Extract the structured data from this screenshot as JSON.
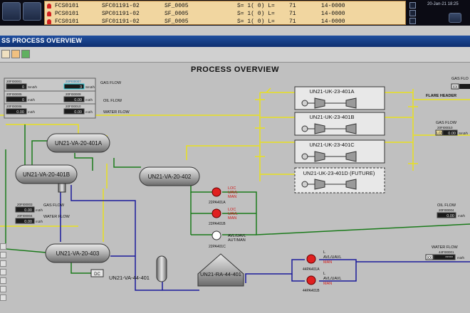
{
  "alarms": [
    {
      "tag": "FCS0101",
      "ref": "SFC01191-02",
      "sf": "SF_0005",
      "state": "S= 1( 0) L=",
      "val": "71",
      "code": "14-0000"
    },
    {
      "tag": "PCS0101",
      "ref": "SPC01191-02",
      "sf": "SF_0005",
      "state": "S= 1( 0) L=",
      "val": "71",
      "code": "14-0000"
    },
    {
      "tag": "FCS0101",
      "ref": "SFC01191-02",
      "sf": "SF_0005",
      "state": "S= 1( 0) L=",
      "val": "71",
      "code": "14-0000"
    }
  ],
  "datetime": "20-Jan-21 18:25",
  "window_title": "SS PROCESS OVERVIEW",
  "page_title": "PROCESS OVERVIEW",
  "left_panel": {
    "rows": [
      {
        "tag1": "20FI00001",
        "val1": "0",
        "unit1": "Sm3/h",
        "tag2": "20PI00007",
        "val2": "3",
        "unit2": "Sm3/h",
        "label": "GAS FLOW"
      },
      {
        "tag1": "20FI00005",
        "val1": "0",
        "unit1": "m3/h",
        "tag2": "20FI00009",
        "val2": "0.00",
        "unit2": "m3/h",
        "label": "OIL FLOW"
      },
      {
        "tag1": "20FI00006",
        "val1": "0.00",
        "unit1": "m3/h",
        "tag2": "20FI00010",
        "val2": "0.00",
        "unit2": "m3/h",
        "label": "WATER FLOW"
      }
    ]
  },
  "vessels": {
    "v401a": "UN21-VA-20-401A",
    "v401b": "UN21-VA-20-401B",
    "v402": "UN21-VA-20-402",
    "v403": "UN21-VA-20-403",
    "v44401": "UN21-VA-44-401",
    "ra44401": "UN21-RA-44-401"
  },
  "compressors": [
    "UN21-UK-23-401A",
    "UN21-UK-23-401B",
    "UN21-UK-23-401C",
    "UN21-UK-23-401D (FUTURE)"
  ],
  "pumps": [
    {
      "tag": "22PA401A",
      "status1": "LOC",
      "status2": "UAVL",
      "status3": "MAN"
    },
    {
      "tag": "22PA401B",
      "status1": "LOC",
      "status2": "UAVL",
      "status3": "MAN"
    },
    {
      "tag": "22PA401C",
      "status1": "AVL/UAVL",
      "status2": "AUT/MAN",
      "status3": ""
    },
    {
      "tag": "44PA401A",
      "status1": "L",
      "status2": "AVL/UAVL",
      "status3": "MAN"
    },
    {
      "tag": "44PA401B",
      "status1": "L",
      "status2": "AVL/UAVL",
      "status3": "MAN"
    }
  ],
  "mid_flows": {
    "gas_tag": "20FI00003",
    "gas_val": "0.00",
    "gas_unit": "m3/h",
    "gas_label": "GAS FLOW",
    "water_tag": "20FI00004",
    "water_val": "0.00",
    "water_unit": "m3/h",
    "water_label": "WATER FLOW"
  },
  "right_panel": {
    "gas_flow_top": "GAS FLO",
    "xx_top": "XX",
    "flare_header": "FLARE HEADER",
    "gas_flow_label": "GAS FLOW",
    "gas_flow_tag": "20FI00010",
    "lo_badge": "LO",
    "gas_flow_val": "0.00",
    "gas_flow_unit": "Sm3/h",
    "oil_flow_label": "OIL FLOW",
    "oil_flow_tag": "20FI00004",
    "oil_flow_val": "0.00",
    "oil_flow_unit": "m3/h",
    "water_flow_label": "WATER FLOW",
    "water_flow_tag": "44FI00001",
    "xx_badge": "XX",
    "water_flow_val": "*****",
    "water_flow_unit": "m3/h"
  },
  "dc_label": "DC",
  "colors": {
    "gas": "#e8e020",
    "oil": "#1a7a1a",
    "water": "#1a1a9a",
    "alarm": "#e02020"
  }
}
